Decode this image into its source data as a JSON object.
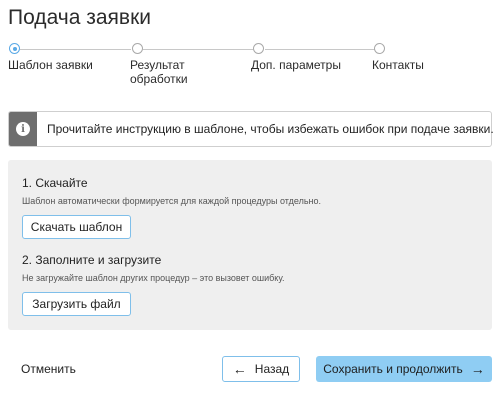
{
  "page": {
    "title": "Подача заявки"
  },
  "steps": [
    {
      "label": "Шаблон заявки"
    },
    {
      "label": "Результат обработки"
    },
    {
      "label": "Доп. параметры"
    },
    {
      "label": "Контакты"
    }
  ],
  "notice": {
    "icon": "info-icon",
    "text": "Прочитайте инструкцию в шаблоне, чтобы избежать ошибок при подаче заявки."
  },
  "section_download": {
    "title": "1. Скачайте",
    "hint": "Шаблон автоматически формируется для каждой процедуры отдельно.",
    "button_label": "Скачать шаблон"
  },
  "section_upload": {
    "title": "2. Заполните и загрузите",
    "hint": "Не загружайте шаблон других процедур – это вызовет ошибку.",
    "button_label": "Загрузить файл"
  },
  "footer": {
    "cancel_label": "Отменить",
    "back_label": "Назад",
    "save_label": "Сохранить и продолжить"
  },
  "colors": {
    "accent": "#5aa9e6",
    "primary_button": "#8fcdf3",
    "panel_background": "#efefef",
    "notice_icon_background": "#6e6e6e"
  }
}
